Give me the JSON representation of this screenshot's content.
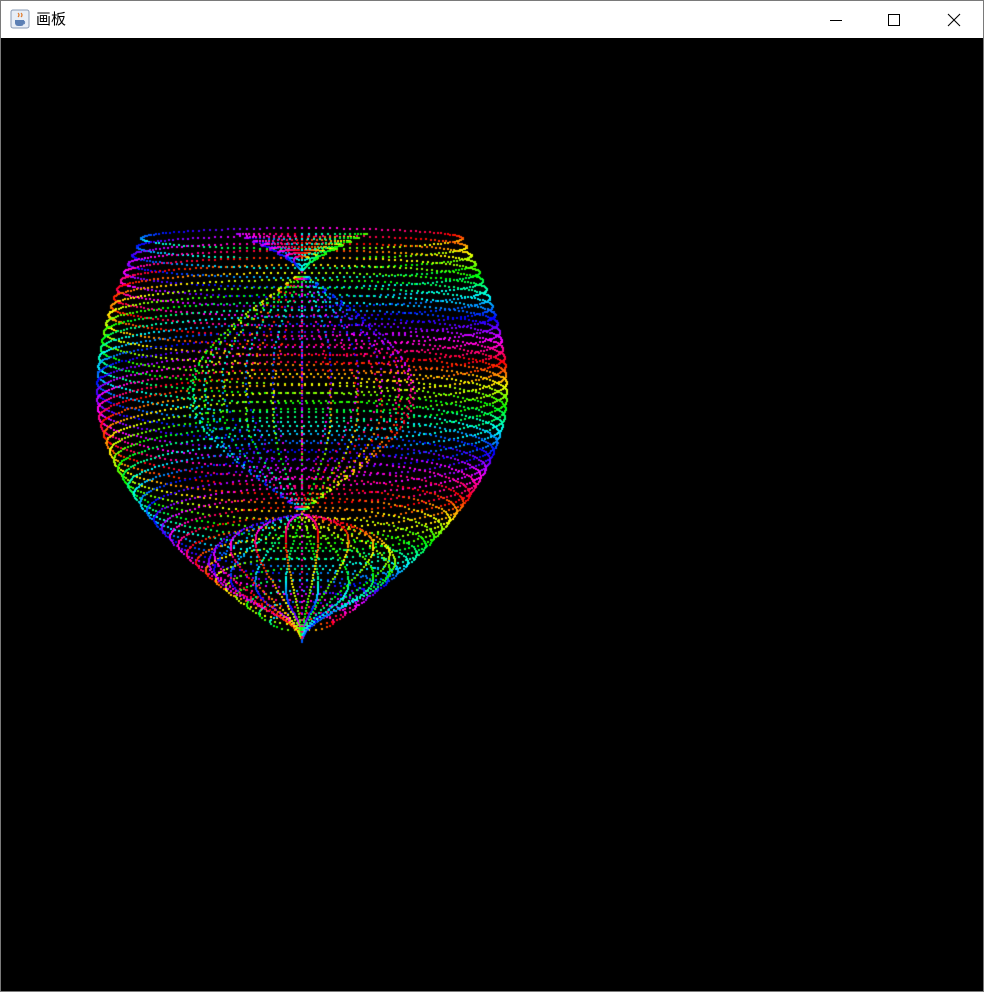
{
  "window": {
    "title": "画板",
    "app_icon": "java-cup-icon",
    "controls": {
      "minimize_icon": "minimize-icon",
      "maximize_icon": "maximize-icon",
      "close_icon": "close-icon"
    }
  },
  "canvas": {
    "background": "#000000",
    "shape": "dotted 3D heart-like surface",
    "palette": [
      "#ff0000",
      "#ff8800",
      "#ffff00",
      "#00ff00",
      "#00ffff",
      "#0000ff",
      "#ff00ff"
    ]
  }
}
